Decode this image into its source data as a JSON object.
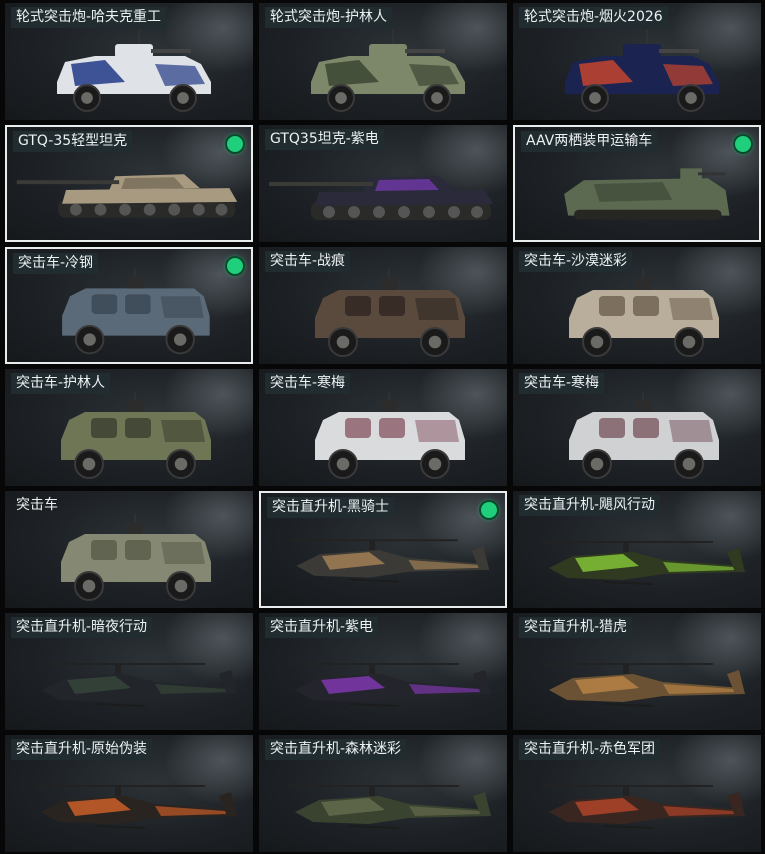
{
  "cards": [
    {
      "label": "轮式突击炮-哈夫克重工",
      "kind": "wheeled",
      "body": "#dfe2e6",
      "camo": "#223a86",
      "owned": false,
      "selected": false
    },
    {
      "label": "轮式突击炮-护林人",
      "kind": "wheeled",
      "body": "#7c8869",
      "camo": "#3c4634",
      "owned": false,
      "selected": false
    },
    {
      "label": "轮式突击炮-烟火2026",
      "kind": "wheeled",
      "body": "#1b2450",
      "camo": "#c4442e",
      "owned": false,
      "selected": false
    },
    {
      "label": "GTQ-35轻型坦克",
      "kind": "tank",
      "body": "#a89a80",
      "camo": "#6e6553",
      "owned": true,
      "selected": true
    },
    {
      "label": "GTQ35坦克-紫电",
      "kind": "tank",
      "body": "#2a2a3a",
      "camo": "#7a3ab8",
      "owned": false,
      "selected": false
    },
    {
      "label": "AAV两栖装甲运输车",
      "kind": "amphib",
      "body": "#5d6a52",
      "camo": "#3f4a38",
      "owned": true,
      "selected": true
    },
    {
      "label": "突击车-冷钢",
      "kind": "mrap",
      "body": "#5b6a78",
      "camo": "#3a4652",
      "owned": true,
      "selected": true
    },
    {
      "label": "突击车-战痕",
      "kind": "mrap",
      "body": "#5a4a3e",
      "camo": "#2e2620",
      "owned": false,
      "selected": false
    },
    {
      "label": "突击车-沙漠迷彩",
      "kind": "mrap",
      "body": "#b9ad9b",
      "camo": "#6d5f4e",
      "owned": false,
      "selected": false
    },
    {
      "label": "突击车-护林人",
      "kind": "mrap",
      "body": "#6f7656",
      "camo": "#3a4030",
      "owned": false,
      "selected": false
    },
    {
      "label": "突击车-寒梅",
      "kind": "mrap",
      "body": "#d9dbdd",
      "camo": "#8a5a66",
      "owned": false,
      "selected": false
    },
    {
      "label": "突击车-寒梅",
      "kind": "mrap",
      "body": "#cfd1d3",
      "camo": "#7a5a62",
      "owned": false,
      "selected": false
    },
    {
      "label": "突击车",
      "kind": "mrap",
      "body": "#858872",
      "camo": "#585b48",
      "owned": false,
      "selected": false
    },
    {
      "label": "突击直升机-黑骑士",
      "kind": "heli",
      "body": "#3b3a36",
      "camo": "#b08a5a",
      "owned": true,
      "selected": true
    },
    {
      "label": "突击直升机-飓风行动",
      "kind": "heli",
      "body": "#2f3a20",
      "camo": "#8fd63a",
      "owned": false,
      "selected": false
    },
    {
      "label": "突击直升机-暗夜行动",
      "kind": "heli",
      "body": "#22262a",
      "camo": "#3a4a3c",
      "owned": false,
      "selected": false
    },
    {
      "label": "突击直升机-紫电",
      "kind": "heli",
      "body": "#24242c",
      "camo": "#8a3ac0",
      "owned": false,
      "selected": false
    },
    {
      "label": "突击直升机-猎虎",
      "kind": "heli",
      "body": "#6b5234",
      "camo": "#c08a48",
      "owned": false,
      "selected": false
    },
    {
      "label": "突击直升机-原始伪装",
      "kind": "heli",
      "body": "#2a2420",
      "camo": "#e0662a",
      "owned": false,
      "selected": false
    },
    {
      "label": "突击直升机-森林迷彩",
      "kind": "heli",
      "body": "#3a4230",
      "camo": "#6a7250",
      "owned": false,
      "selected": false
    },
    {
      "label": "突击直升机-赤色军团",
      "kind": "heli",
      "body": "#3a2620",
      "camo": "#c0482a",
      "owned": false,
      "selected": false
    }
  ]
}
